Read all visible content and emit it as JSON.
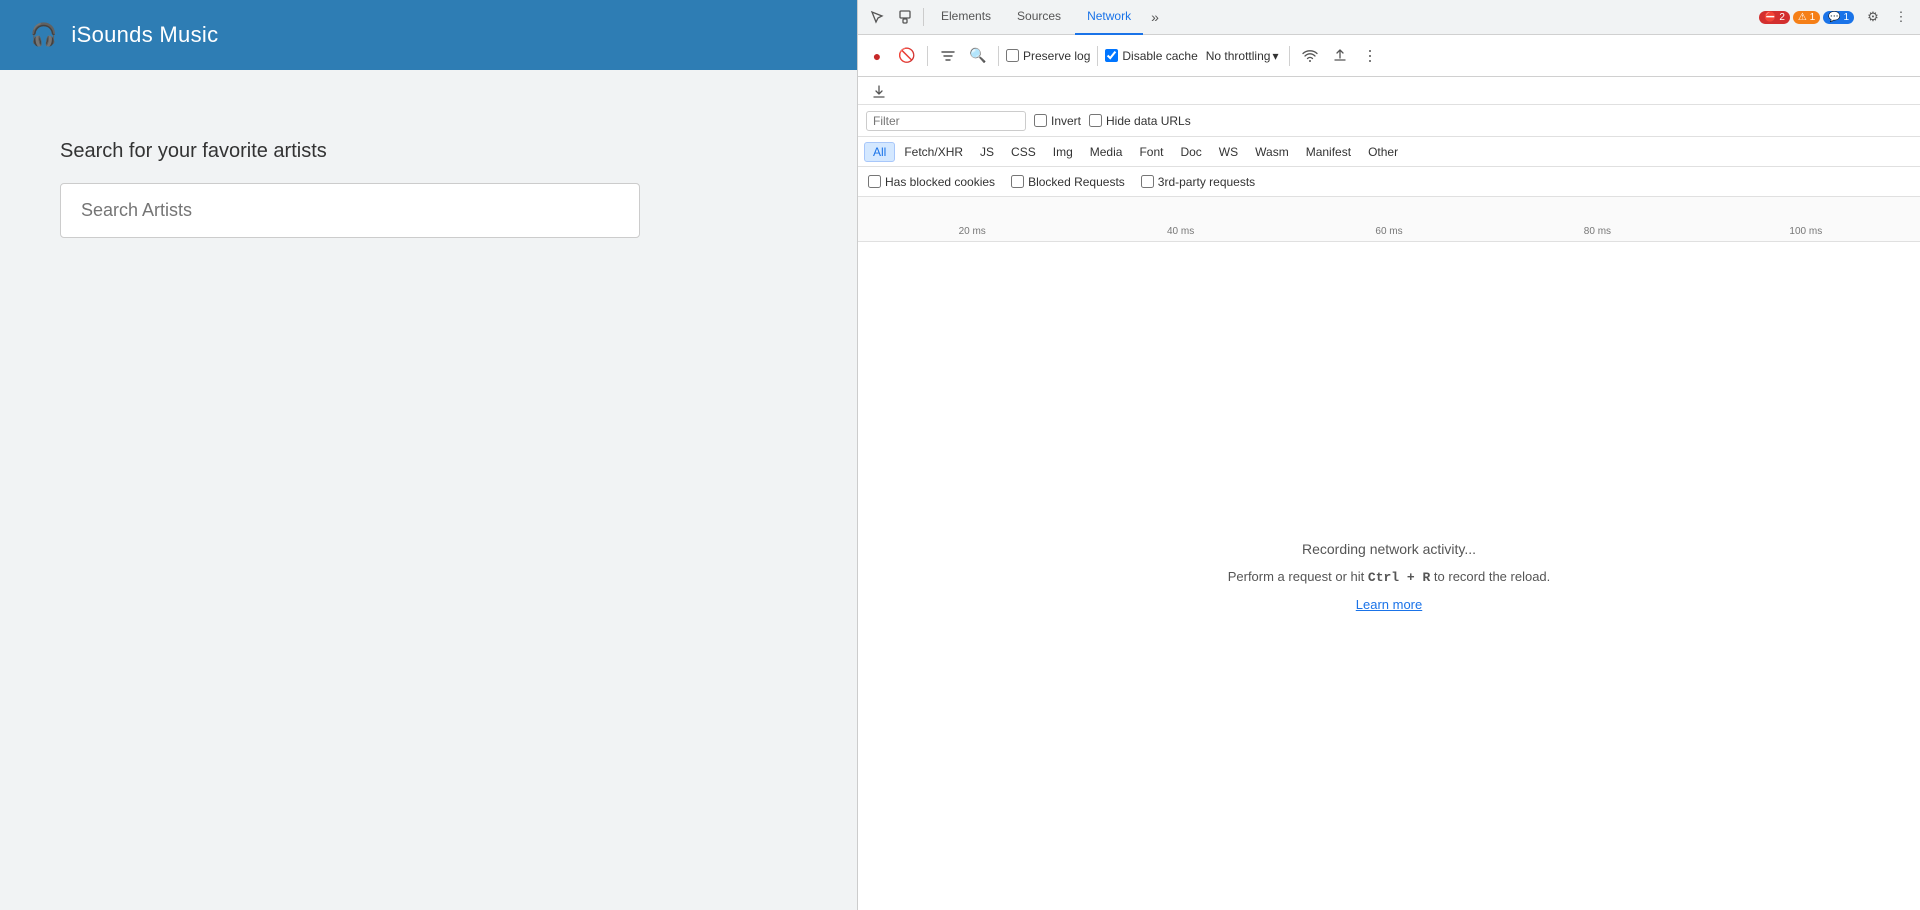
{
  "app": {
    "header": {
      "icon": "🎧",
      "title": "iSounds Music"
    },
    "search": {
      "label": "Search for your favorite artists",
      "placeholder": "Search Artists"
    }
  },
  "devtools": {
    "tabs": [
      {
        "id": "elements",
        "label": "Elements",
        "active": false
      },
      {
        "id": "sources",
        "label": "Sources",
        "active": false
      },
      {
        "id": "network",
        "label": "Network",
        "active": true
      }
    ],
    "badges": {
      "errors": "2",
      "warnings": "1",
      "messages": "1"
    },
    "toolbar": {
      "preserve_log_label": "Preserve log",
      "disable_cache_label": "Disable cache",
      "no_throttling_label": "No throttling"
    },
    "filter": {
      "placeholder": "Filter",
      "invert_label": "Invert",
      "hide_data_urls_label": "Hide data URLs"
    },
    "type_filters": [
      "All",
      "Fetch/XHR",
      "JS",
      "CSS",
      "Img",
      "Media",
      "Font",
      "Doc",
      "WS",
      "Wasm",
      "Manifest",
      "Other"
    ],
    "active_type": "All",
    "check_row": {
      "has_blocked_cookies": "Has blocked cookies",
      "blocked_requests": "Blocked Requests",
      "third_party": "3rd-party requests"
    },
    "timeline": {
      "markers": [
        "20 ms",
        "40 ms",
        "60 ms",
        "80 ms",
        "100 ms"
      ]
    },
    "empty_state": {
      "title": "Recording network activity...",
      "subtitle_pre": "Perform a request or hit ",
      "shortcut": "Ctrl + R",
      "subtitle_post": " to record the reload.",
      "link": "Learn more"
    }
  }
}
